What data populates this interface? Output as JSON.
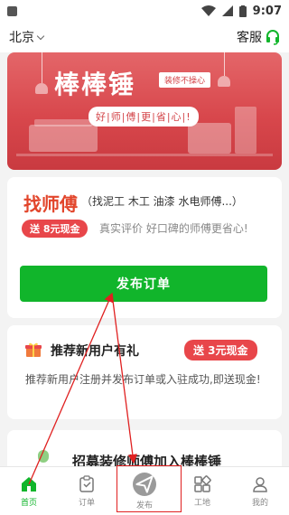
{
  "status_bar": {
    "time": "9:07"
  },
  "header": {
    "city": "北京",
    "service_label": "客服"
  },
  "banner": {
    "title": "棒棒锤",
    "tag": "装修不操心",
    "slogan": "好|师|傅|更|省|心|!"
  },
  "find_card": {
    "title": "找师傅",
    "subtitle": "（找泥工 木工 油漆 水电师傅...）",
    "pill": "送 8元现金",
    "desc": "真实评价 好口碑的师傅更省心!",
    "button": "发布订单"
  },
  "recommend_card": {
    "title": "推荐新用户有礼",
    "pill": "送 3元现金",
    "desc": "推荐新用户注册并发布订单或入驻成功,即送现金!"
  },
  "recruit_card": {
    "title": "招募装修师傅加入棒棒锤"
  },
  "tabs": [
    {
      "label": "首页",
      "icon": "home-icon"
    },
    {
      "label": "订单",
      "icon": "order-icon"
    },
    {
      "label": "发布",
      "icon": "send-icon"
    },
    {
      "label": "工地",
      "icon": "grid-icon"
    },
    {
      "label": "我的",
      "icon": "user-icon"
    }
  ],
  "colors": {
    "brand_green": "#11b52b",
    "accent_red": "#e8464a",
    "banner_red": "#d8474c",
    "annotation_red": "#e02020"
  }
}
